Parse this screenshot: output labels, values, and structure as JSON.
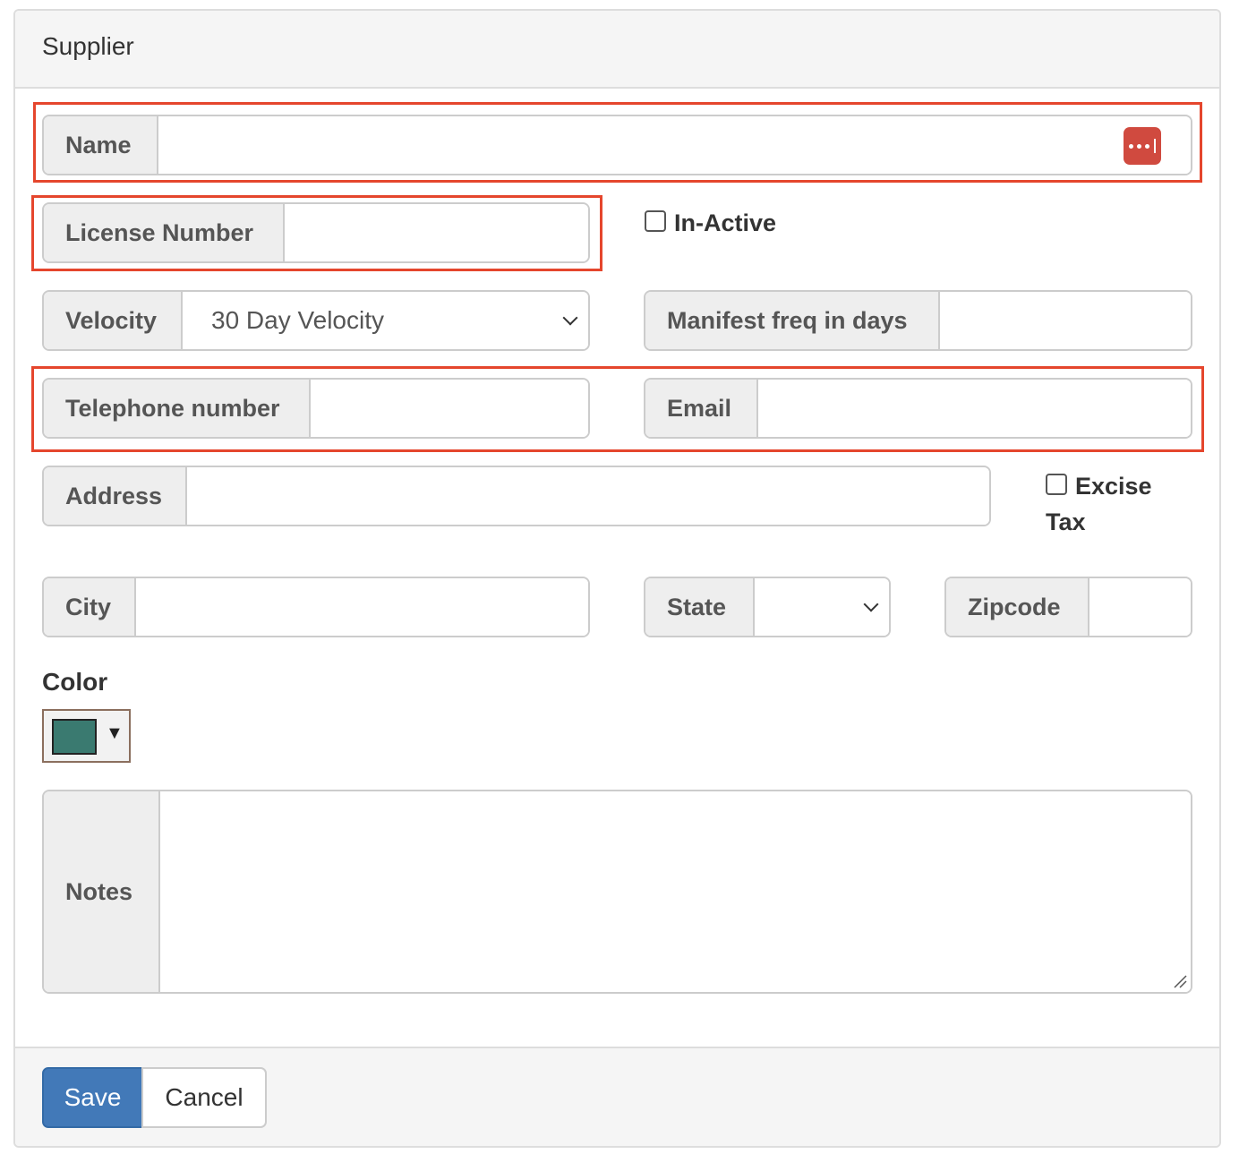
{
  "panel": {
    "title": "Supplier"
  },
  "fields": {
    "name": {
      "label": "Name",
      "value": ""
    },
    "license_number": {
      "label": "License Number",
      "value": ""
    },
    "in_active": {
      "label": "In-Active",
      "checked": false
    },
    "velocity": {
      "label": "Velocity",
      "selected": "30 Day Velocity"
    },
    "manifest_freq": {
      "label": "Manifest freq in days",
      "value": ""
    },
    "telephone": {
      "label": "Telephone number",
      "value": ""
    },
    "email": {
      "label": "Email",
      "value": ""
    },
    "address": {
      "label": "Address",
      "value": ""
    },
    "excise_tax": {
      "label_line1": "Excise",
      "label_line2": "Tax",
      "checked": false
    },
    "city": {
      "label": "City",
      "value": ""
    },
    "state": {
      "label": "State",
      "selected": ""
    },
    "zipcode": {
      "label": "Zipcode",
      "value": ""
    },
    "color": {
      "label": "Color",
      "value": "#3a7a70",
      "arrow": "▼"
    },
    "notes": {
      "label": "Notes",
      "value": ""
    }
  },
  "footer": {
    "save_label": "Save",
    "cancel_label": "Cancel"
  },
  "colors": {
    "highlight": "#e5462d",
    "primary": "#4279b8",
    "password_manager": "#d04a3f"
  },
  "icons": {
    "password_manager": "password-manager-icon",
    "select_arrow": "chevron-down-icon"
  }
}
